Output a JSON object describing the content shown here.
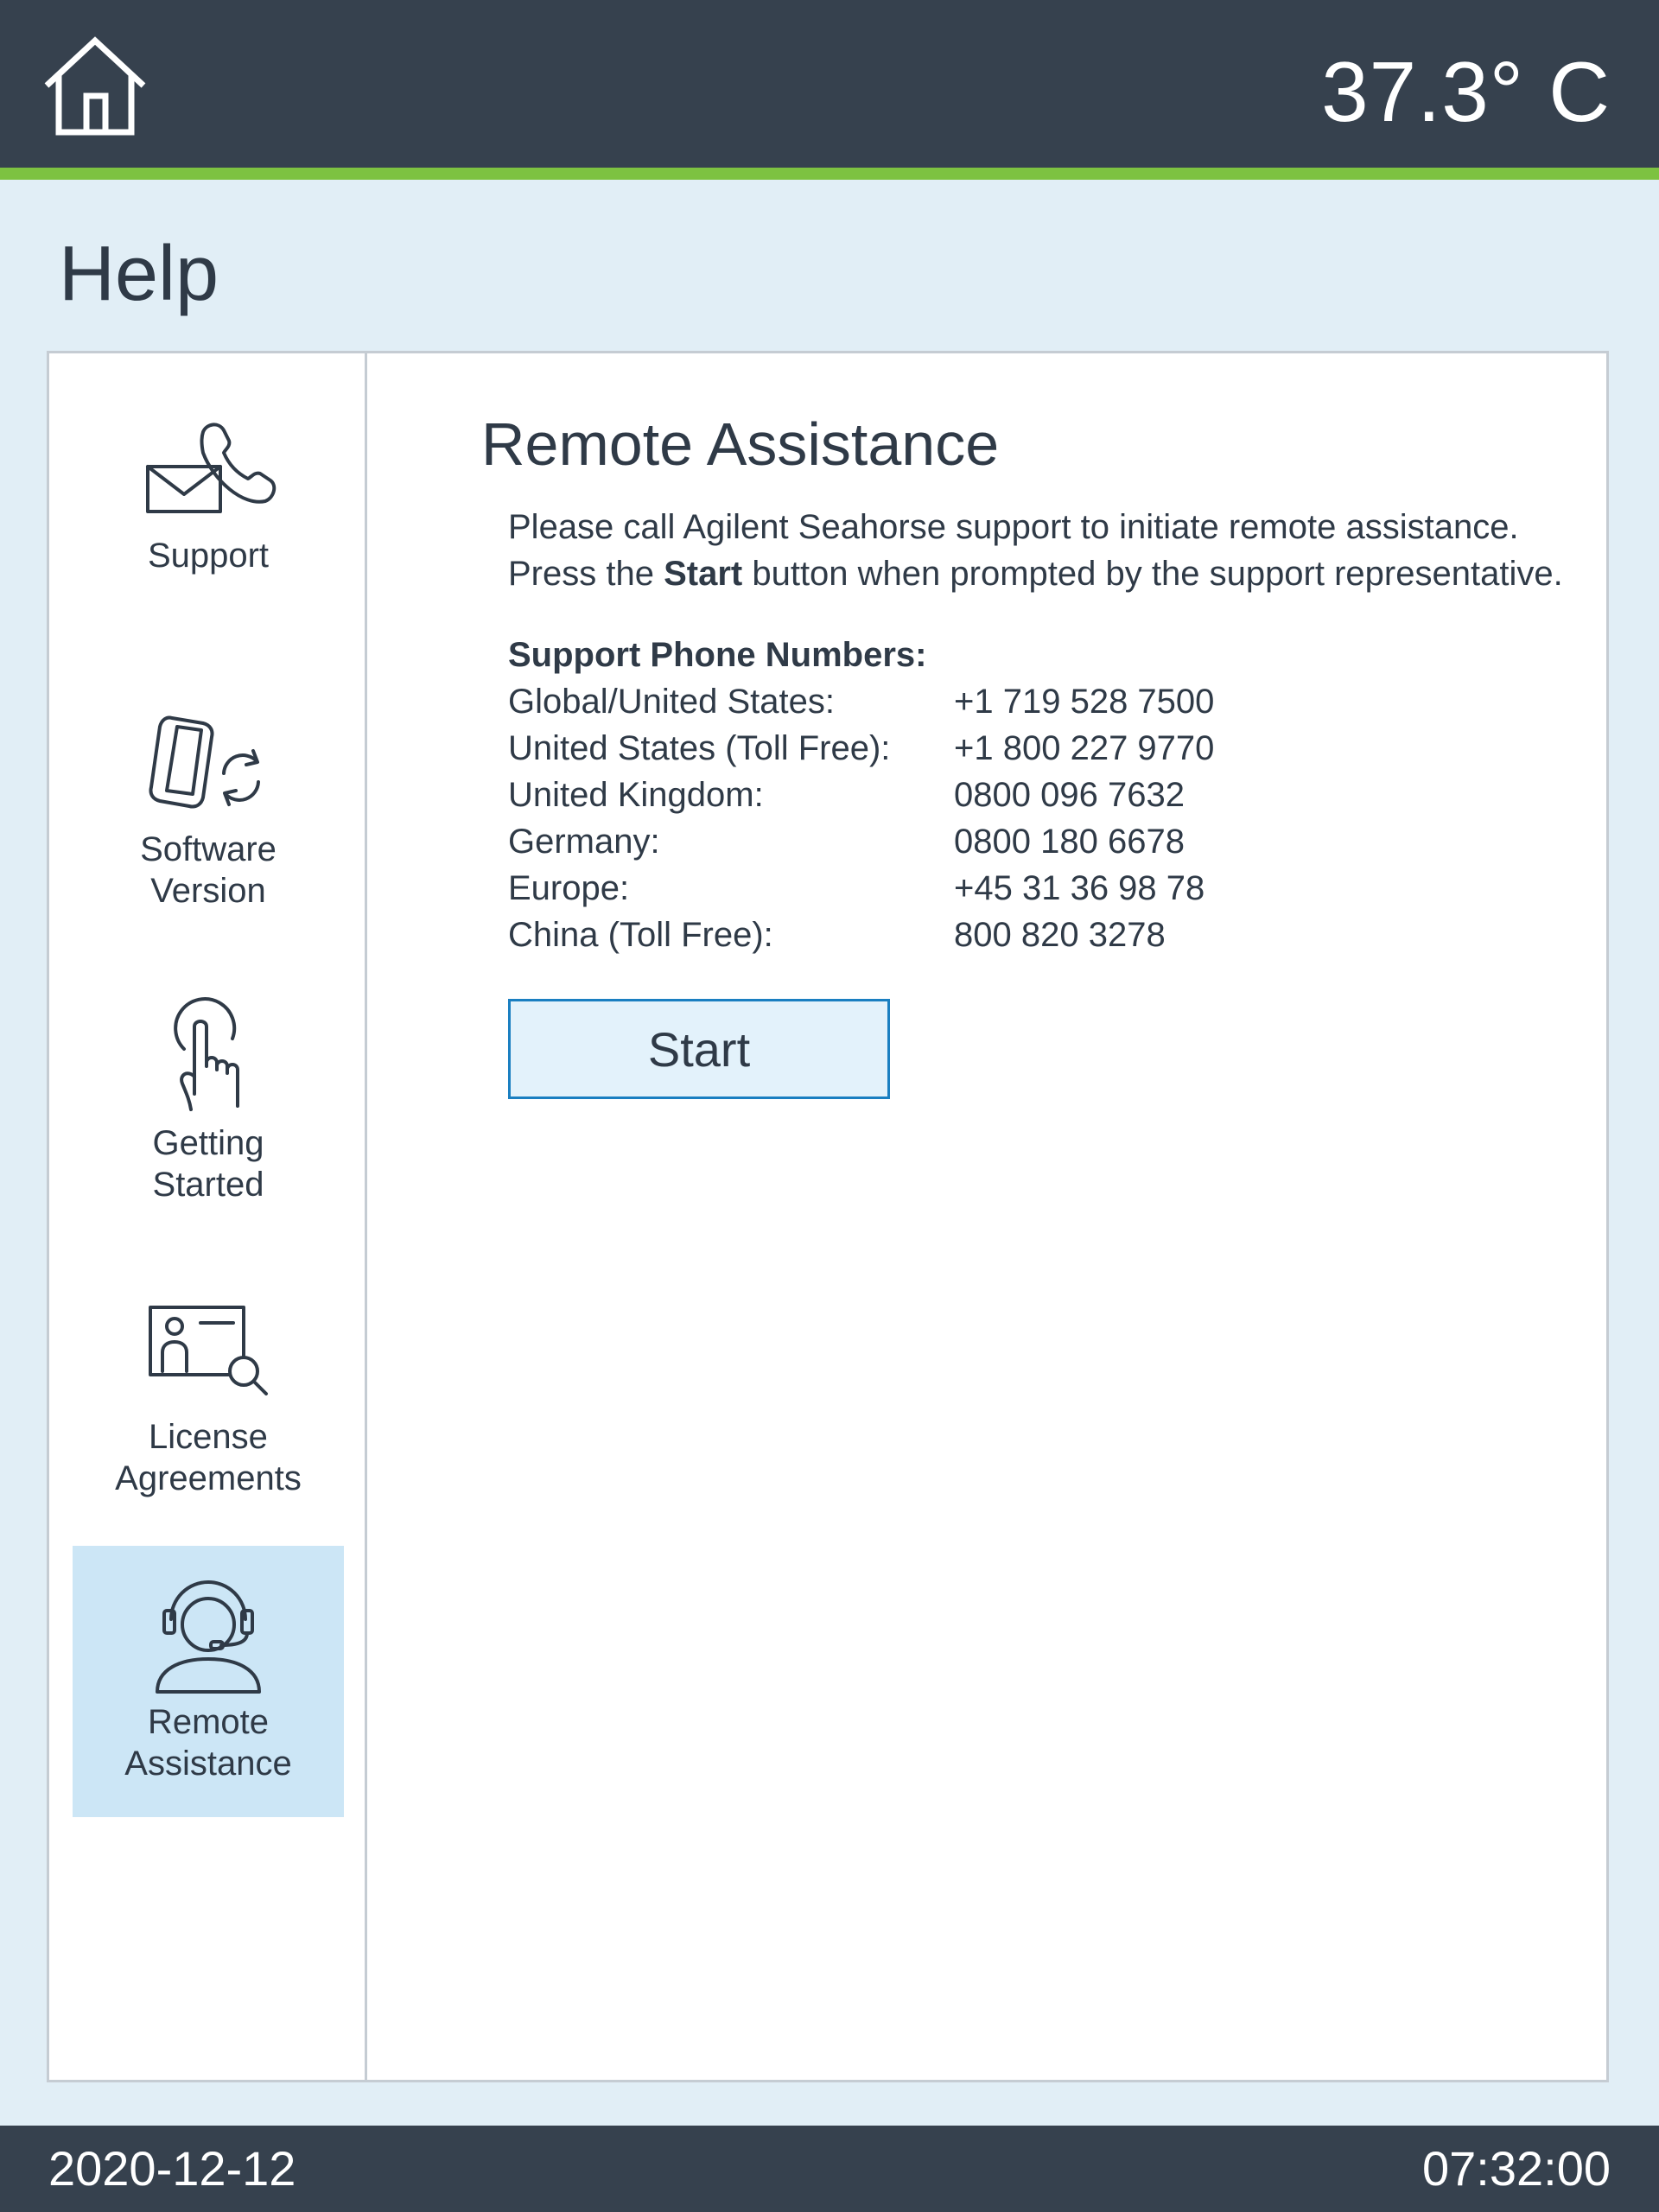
{
  "header": {
    "temperature": "37.3° C"
  },
  "page": {
    "title": "Help"
  },
  "sidebar": {
    "items": [
      {
        "label": "Support",
        "icon": "support-envelope-phone-icon"
      },
      {
        "label": "Software\nVersion",
        "icon": "software-version-tablet-sync-icon"
      },
      {
        "label": "Getting\nStarted",
        "icon": "touch-hand-icon"
      },
      {
        "label": "License\nAgreements",
        "icon": "license-document-search-icon"
      },
      {
        "label": "Remote\nAssistance",
        "icon": "headset-person-icon",
        "active": true
      }
    ]
  },
  "main": {
    "title": "Remote Assistance",
    "intro_line1": "Please call Agilent Seahorse support to initiate remote assistance.",
    "intro_line2_prefix": "Press the ",
    "intro_line2_bold": "Start",
    "intro_line2_suffix": " button when prompted by the support representative.",
    "phones_header": "Support Phone Numbers:",
    "phones": [
      {
        "region": "Global/United States:",
        "number": "+1 719 528 7500"
      },
      {
        "region": "United States (Toll Free):",
        "number": "+1 800 227 9770"
      },
      {
        "region": "United Kingdom:",
        "number": "0800 096 7632"
      },
      {
        "region": "Germany:",
        "number": "0800 180 6678"
      },
      {
        "region": "Europe:",
        "number": "+45 31 36 98 78"
      },
      {
        "region": "China (Toll Free):",
        "number": "800 820 3278"
      }
    ],
    "start_label": "Start"
  },
  "footer": {
    "date": "2020-12-12",
    "time": "07:32:00"
  },
  "colors": {
    "header_bg": "#36414e",
    "accent_green": "#7dc241",
    "page_bg": "#e1eef6",
    "active_item_bg": "#cce6f6",
    "button_border": "#1a7fc1",
    "button_bg": "#e3f2fb"
  }
}
